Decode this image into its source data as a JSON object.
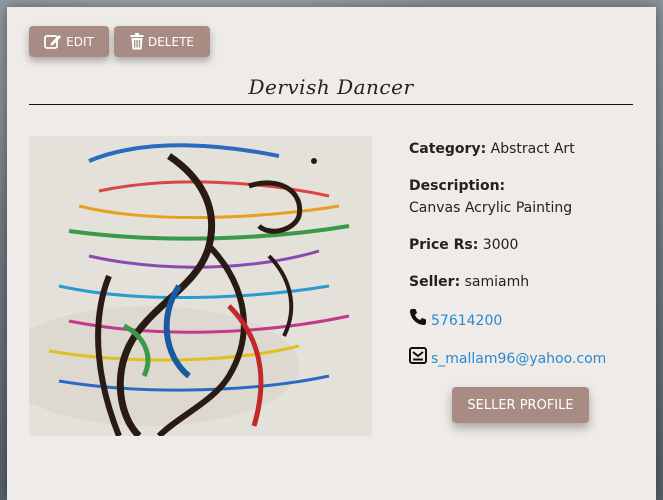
{
  "toolbar": {
    "edit_label": "EDIT",
    "delete_label": "DELETE"
  },
  "item": {
    "title": "Dervish Dancer",
    "category_label": "Category:",
    "category": "Abstract Art",
    "description_label": "Description:",
    "description": "Canvas Acrylic Painting",
    "price_label": "Price Rs:",
    "price": "3000",
    "seller_label": "Seller:",
    "seller": "samiamh",
    "phone": "57614200",
    "email": "s_mallam96@yahoo.com"
  },
  "actions": {
    "seller_profile_label": "SELLER PROFILE"
  },
  "colors": {
    "button": "#a88c84",
    "modal_bg": "#efebe8",
    "link": "#2a8ad0"
  },
  "icons": {
    "edit": "pencil-square-icon",
    "delete": "trash-icon",
    "phone": "phone-icon",
    "email": "envelope-icon"
  }
}
